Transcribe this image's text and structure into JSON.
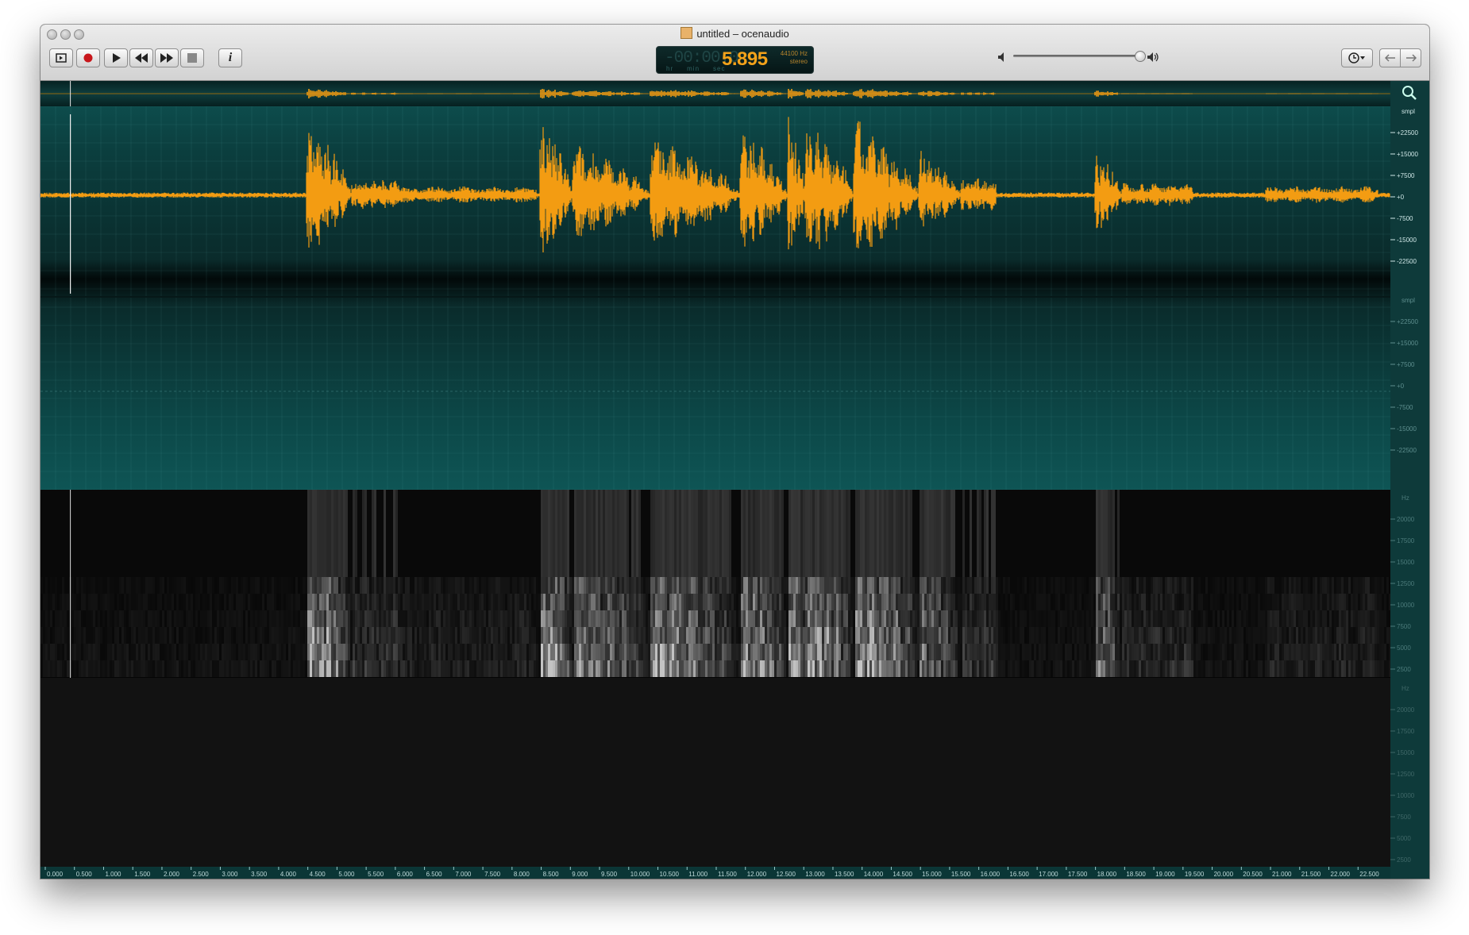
{
  "window": {
    "title": "untitled – ocenaudio"
  },
  "toolbar": {
    "buttons": [
      {
        "name": "loop-play-button",
        "icon": "loop-icon"
      },
      {
        "name": "record-button",
        "icon": "record-icon"
      },
      {
        "name": "play-button",
        "icon": "play-icon"
      },
      {
        "name": "rewind-button",
        "icon": "rewind-icon"
      },
      {
        "name": "fast-forward-button",
        "icon": "fast-forward-icon"
      },
      {
        "name": "stop-button",
        "icon": "stop-icon"
      },
      {
        "name": "info-button",
        "icon": "info-icon",
        "label": "i"
      }
    ],
    "time_display": {
      "dim_digits": "-00:00:0",
      "seconds": "5.895",
      "sample_rate": "44100 Hz",
      "channels": "stereo",
      "units": [
        "hr",
        "min",
        "sec"
      ]
    },
    "volume": {
      "level": 0.95,
      "min_icon": "speaker-low-icon",
      "max_icon": "speaker-high-icon"
    },
    "right_buttons": [
      {
        "name": "history-dropdown-button",
        "icon": "clock-icon"
      },
      {
        "name": "back-button",
        "icon": "arrow-left-icon"
      },
      {
        "name": "forward-button",
        "icon": "arrow-right-icon"
      }
    ]
  },
  "waveform": {
    "color": "#f39c12",
    "amplitude_unit": "smpl",
    "amplitude_ticks": [
      "+22500",
      "+15000",
      "+7500",
      "+0",
      "-7500",
      "-15000",
      "-22500"
    ],
    "cursor_time_sec": 0.5
  },
  "spectrogram": {
    "freq_unit": "Hz",
    "freq_ticks": [
      "20000",
      "17500",
      "15000",
      "12500",
      "10000",
      "7500",
      "5000",
      "2500"
    ]
  },
  "timeline": {
    "ticks": [
      "0.000",
      "0.500",
      "1.000",
      "1.500",
      "2.000",
      "2.500",
      "3.000",
      "3.500",
      "4.000",
      "4.500",
      "5.000",
      "5.500",
      "6.000",
      "6.500",
      "7.000",
      "7.500",
      "8.000",
      "8.500",
      "9.000",
      "9.500",
      "10.000",
      "10.500",
      "11.000",
      "11.500",
      "12.000",
      "12.500",
      "13.000",
      "13.500",
      "14.000",
      "14.500",
      "15.000",
      "15.500",
      "16.000",
      "16.500",
      "17.000",
      "17.500",
      "18.000",
      "18.500",
      "19.000",
      "19.500",
      "20.000",
      "20.500",
      "21.000",
      "21.500",
      "22.000",
      "22.500"
    ]
  },
  "colors": {
    "accent": "#f39c12",
    "panel_teal": "#0d4c4c",
    "lcd_digits": "#f3a21a"
  }
}
